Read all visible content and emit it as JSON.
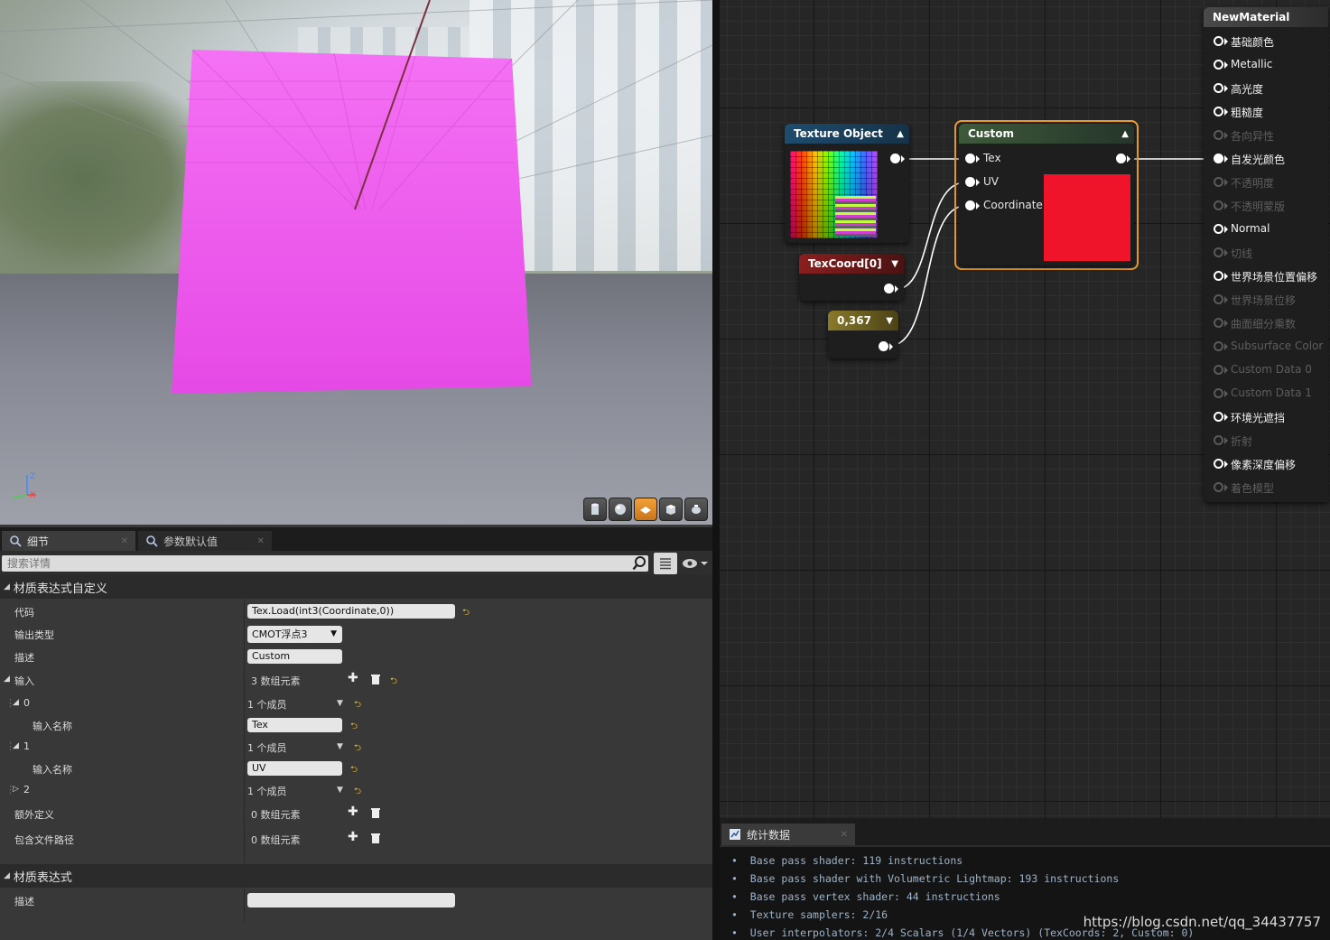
{
  "details": {
    "tabs": [
      {
        "label": "细节",
        "icon": "magnifier-icon"
      },
      {
        "label": "参数默认值",
        "icon": "magnifier-icon"
      }
    ],
    "search": {
      "placeholder": "搜索详情"
    },
    "sections": [
      {
        "title": "材质表达式自定义",
        "rows": {
          "code": {
            "label": "代码",
            "value": "Tex.Load(int3(Coordinate,0))"
          },
          "output_type": {
            "label": "输出类型",
            "value": "CMOT浮点3"
          },
          "description": {
            "label": "描述",
            "value": "Custom"
          },
          "inputs": {
            "label": "输入",
            "value": "3 数组元素"
          },
          "input_0": {
            "label": "0",
            "value": "1 个成员",
            "name_label": "输入名称",
            "name_value": "Tex"
          },
          "input_1": {
            "label": "1",
            "value": "1 个成员",
            "name_label": "输入名称",
            "name_value": "UV"
          },
          "input_2": {
            "label": "2",
            "value": "1 个成员"
          },
          "extra_defines": {
            "label": "额外定义",
            "value": "0 数组元素"
          },
          "include_paths": {
            "label": "包含文件路径",
            "value": "0 数组元素"
          }
        }
      },
      {
        "title": "材质表达式",
        "rows": {
          "description": {
            "label": "描述",
            "value": ""
          }
        }
      }
    ]
  },
  "graph": {
    "texture_object": {
      "title": "Texture Object"
    },
    "texcoord": {
      "title": "TexCoord[0]"
    },
    "constant": {
      "title": "0,367"
    },
    "custom": {
      "title": "Custom",
      "inputs": [
        "Tex",
        "UV",
        "Coordinate"
      ],
      "preview_color": "#f0142a"
    },
    "material": {
      "title": "NewMaterial",
      "pins": [
        {
          "label": "基础颜色",
          "active": true
        },
        {
          "label": "Metallic",
          "active": true
        },
        {
          "label": "高光度",
          "active": true
        },
        {
          "label": "粗糙度",
          "active": true
        },
        {
          "label": "各向异性",
          "active": false
        },
        {
          "label": "自发光颜色",
          "active": true,
          "connected": true
        },
        {
          "label": "不透明度",
          "active": false
        },
        {
          "label": "不透明蒙版",
          "active": false
        },
        {
          "label": "Normal",
          "active": true
        },
        {
          "label": "切线",
          "active": false
        },
        {
          "label": "世界场景位置偏移",
          "active": true
        },
        {
          "label": "世界场景位移",
          "active": false
        },
        {
          "label": "曲面细分乘数",
          "active": false
        },
        {
          "label": "Subsurface Color",
          "active": false
        },
        {
          "label": "Custom Data 0",
          "active": false
        },
        {
          "label": "Custom Data 1",
          "active": false
        },
        {
          "label": "环境光遮挡",
          "active": true
        },
        {
          "label": "折射",
          "active": false
        },
        {
          "label": "像素深度偏移",
          "active": true
        },
        {
          "label": "着色模型",
          "active": false
        }
      ]
    }
  },
  "stats": {
    "tab_label": "统计数据",
    "lines": [
      "Base pass shader: 119 instructions",
      "Base pass shader with Volumetric Lightmap: 193 instructions",
      "Base pass vertex shader: 44 instructions",
      "Texture samplers: 2/16",
      "User interpolators: 2/4 Scalars (1/4 Vectors) (TexCoords: 2, Custom: 0)"
    ]
  },
  "viewport": {
    "toolbar": [
      "cylinder-icon",
      "sphere-icon",
      "plane-icon",
      "cube-icon",
      "teapot-icon"
    ],
    "active_tool": "plane-icon",
    "axis_labels": {
      "z": "Z",
      "x": "X"
    }
  },
  "watermark": "https://blog.csdn.net/qq_34437757",
  "colors": {
    "accent": "#f0a030",
    "plane": "#f05cf0",
    "texcoord_header": "#8a1f1f",
    "constant_header": "#8a7a2a",
    "custom_header": "#3e5a3a",
    "texture_header": "#1f4c6e"
  }
}
